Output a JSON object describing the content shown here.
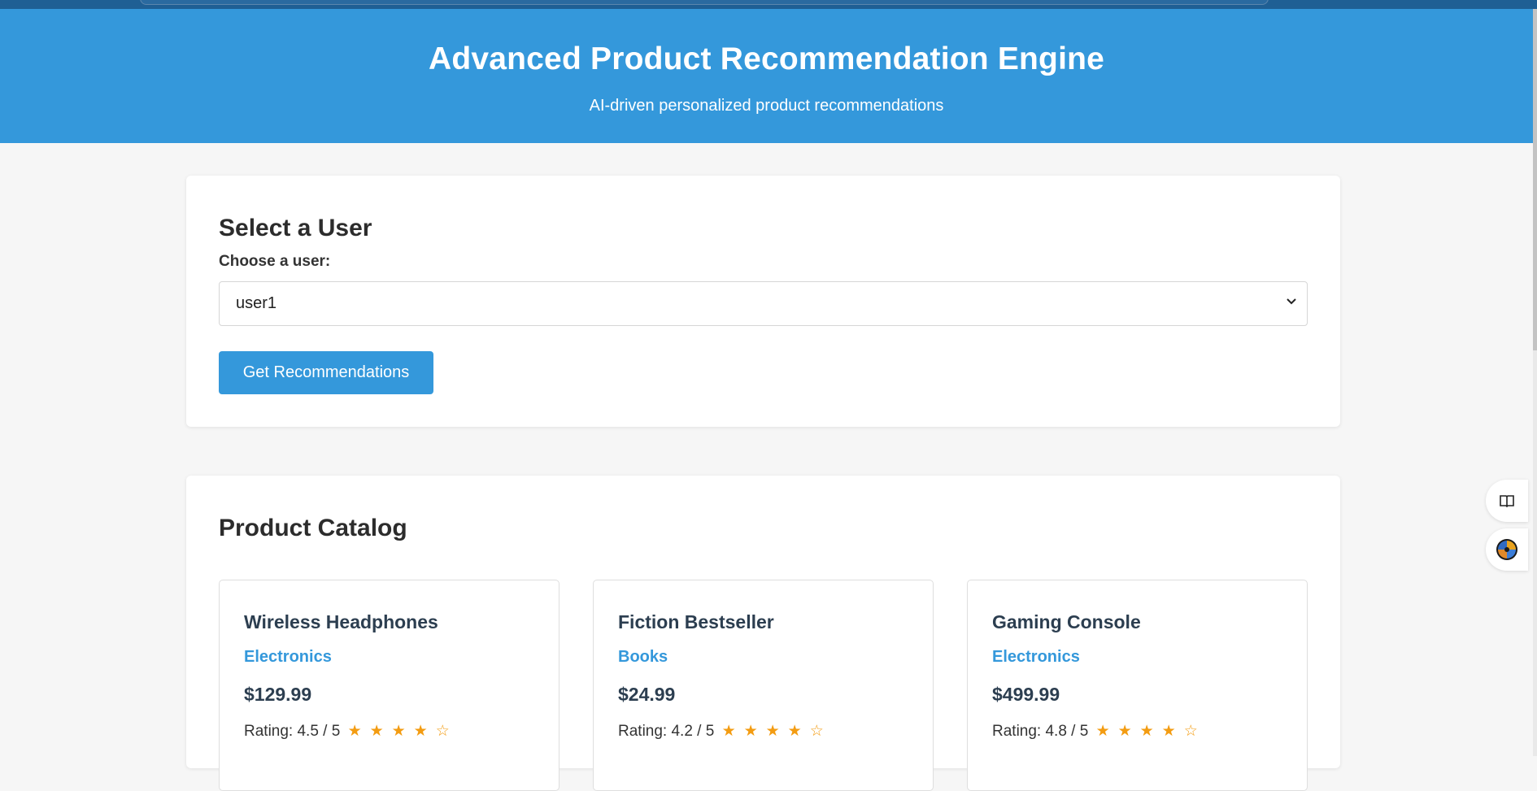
{
  "header": {
    "title": "Advanced Product Recommendation Engine",
    "subtitle": "AI-driven personalized product recommendations"
  },
  "user_section": {
    "heading": "Select a User",
    "label": "Choose a user:",
    "selected_user": "user1",
    "button_label": "Get Recommendations"
  },
  "catalog": {
    "heading": "Product Catalog",
    "products": [
      {
        "name": "Wireless Headphones",
        "category": "Electronics",
        "price": "$129.99",
        "rating_text": "Rating: 4.5 / 5",
        "stars": "★★★★☆",
        "rating": 4.5
      },
      {
        "name": "Fiction Bestseller",
        "category": "Books",
        "price": "$24.99",
        "rating_text": "Rating: 4.2 / 5",
        "stars": "★★★★☆",
        "rating": 4.2
      },
      {
        "name": "Gaming Console",
        "category": "Electronics",
        "price": "$499.99",
        "rating_text": "Rating: 4.8 / 5",
        "stars": "★★★★☆",
        "rating": 4.8
      }
    ]
  },
  "colors": {
    "accent": "#3498db",
    "star": "#f39c12",
    "text_dark": "#2c3e50"
  },
  "icons": {
    "side_button_1": "book-icon",
    "side_button_2": "extension-icon"
  }
}
